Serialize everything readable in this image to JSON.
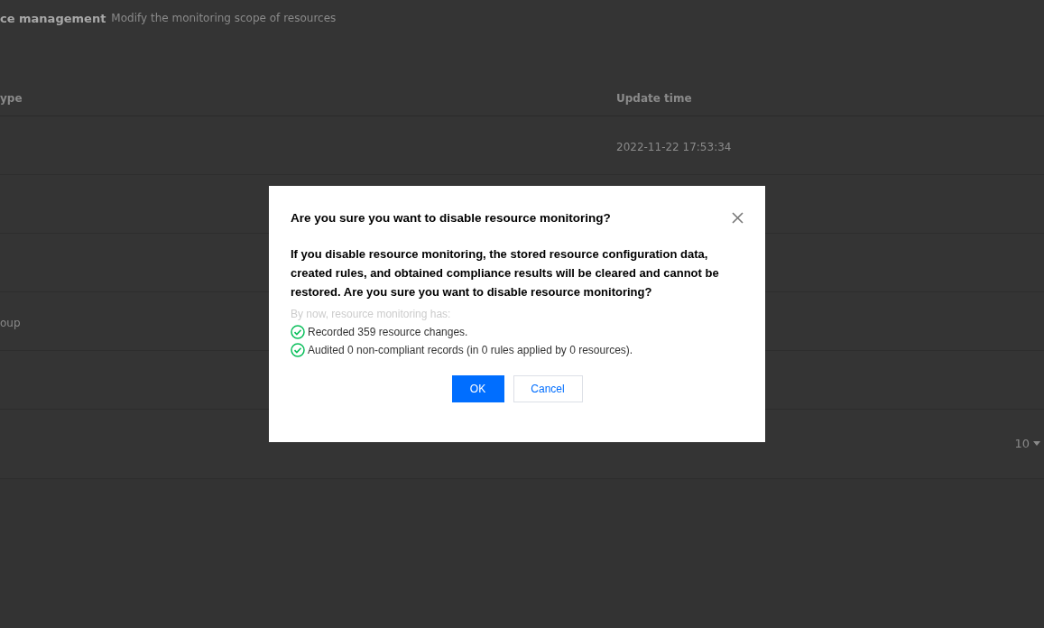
{
  "page": {
    "title": "ce management",
    "subtitle": "Modify the monitoring scope of resources"
  },
  "table": {
    "columns": [
      "ype",
      "Update time"
    ],
    "rows": [
      [
        "",
        "2022-11-22 17:53:34"
      ],
      [
        "",
        ""
      ],
      [
        "",
        ""
      ],
      [
        "oup",
        ""
      ],
      [
        "",
        ""
      ]
    ]
  },
  "pagination": {
    "page_size": "10"
  },
  "dialog": {
    "title": "Are you sure you want to disable resource monitoring?",
    "message": "If you disable resource monitoring, the stored resource configuration data, created rules, and obtained compliance results will be cleared and cannot be restored. Are you sure you want to disable resource monitoring?",
    "summary_label": "By now, resource monitoring has:",
    "items": [
      "Recorded 359 resource changes.",
      "Audited 0 non-compliant records (in 0 rules applied by 0 resources)."
    ],
    "buttons": [
      {
        "label": "OK",
        "kind": "primary"
      },
      {
        "label": "Cancel",
        "kind": "secondary"
      }
    ]
  }
}
